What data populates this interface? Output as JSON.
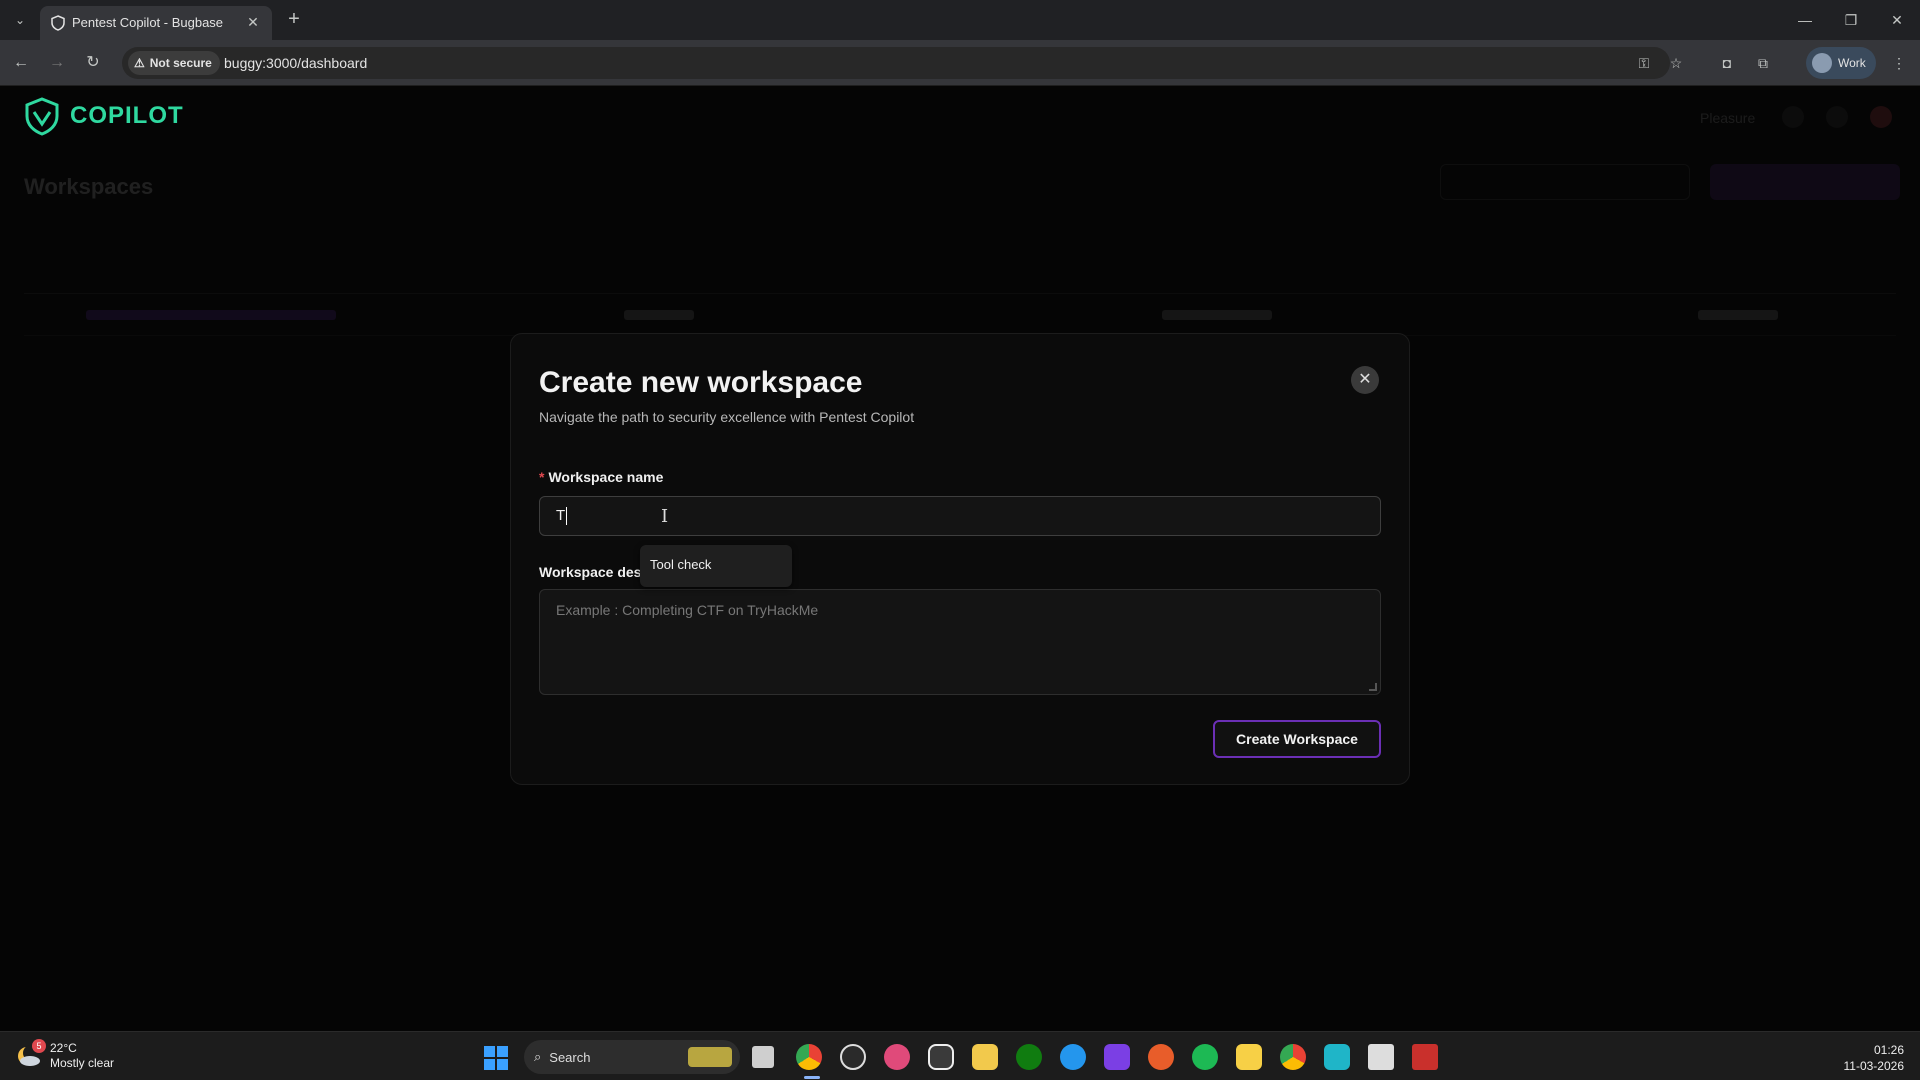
{
  "browser": {
    "tab_title": "Pentest Copilot - Bugbase",
    "security_label": "Not secure",
    "url": "buggy:3000/dashboard",
    "profile_label": "Work"
  },
  "app": {
    "logo_text": "COPILOT",
    "header_right_text": "Pleasure",
    "page_title": "Workspaces"
  },
  "modal": {
    "title": "Create new workspace",
    "subtitle": "Navigate the path to security excellence with Pentest Copilot",
    "name_label": "Workspace name",
    "name_required_mark": "*",
    "name_value": "T",
    "desc_label": "Workspace des",
    "desc_placeholder": "Example : Completing CTF on TryHackMe",
    "autocomplete_suggestion": "Tool check",
    "submit_label": "Create Workspace"
  },
  "taskbar": {
    "weather_badge": "5",
    "temperature": "22°C",
    "weather_condition": "Mostly clear",
    "search_label": "Search",
    "time": "01:26",
    "date": "11-03-2026"
  },
  "colors": {
    "accent_logo": "#2fd9a0",
    "button_border": "#6b2fb5",
    "required_mark": "#e0484f"
  }
}
